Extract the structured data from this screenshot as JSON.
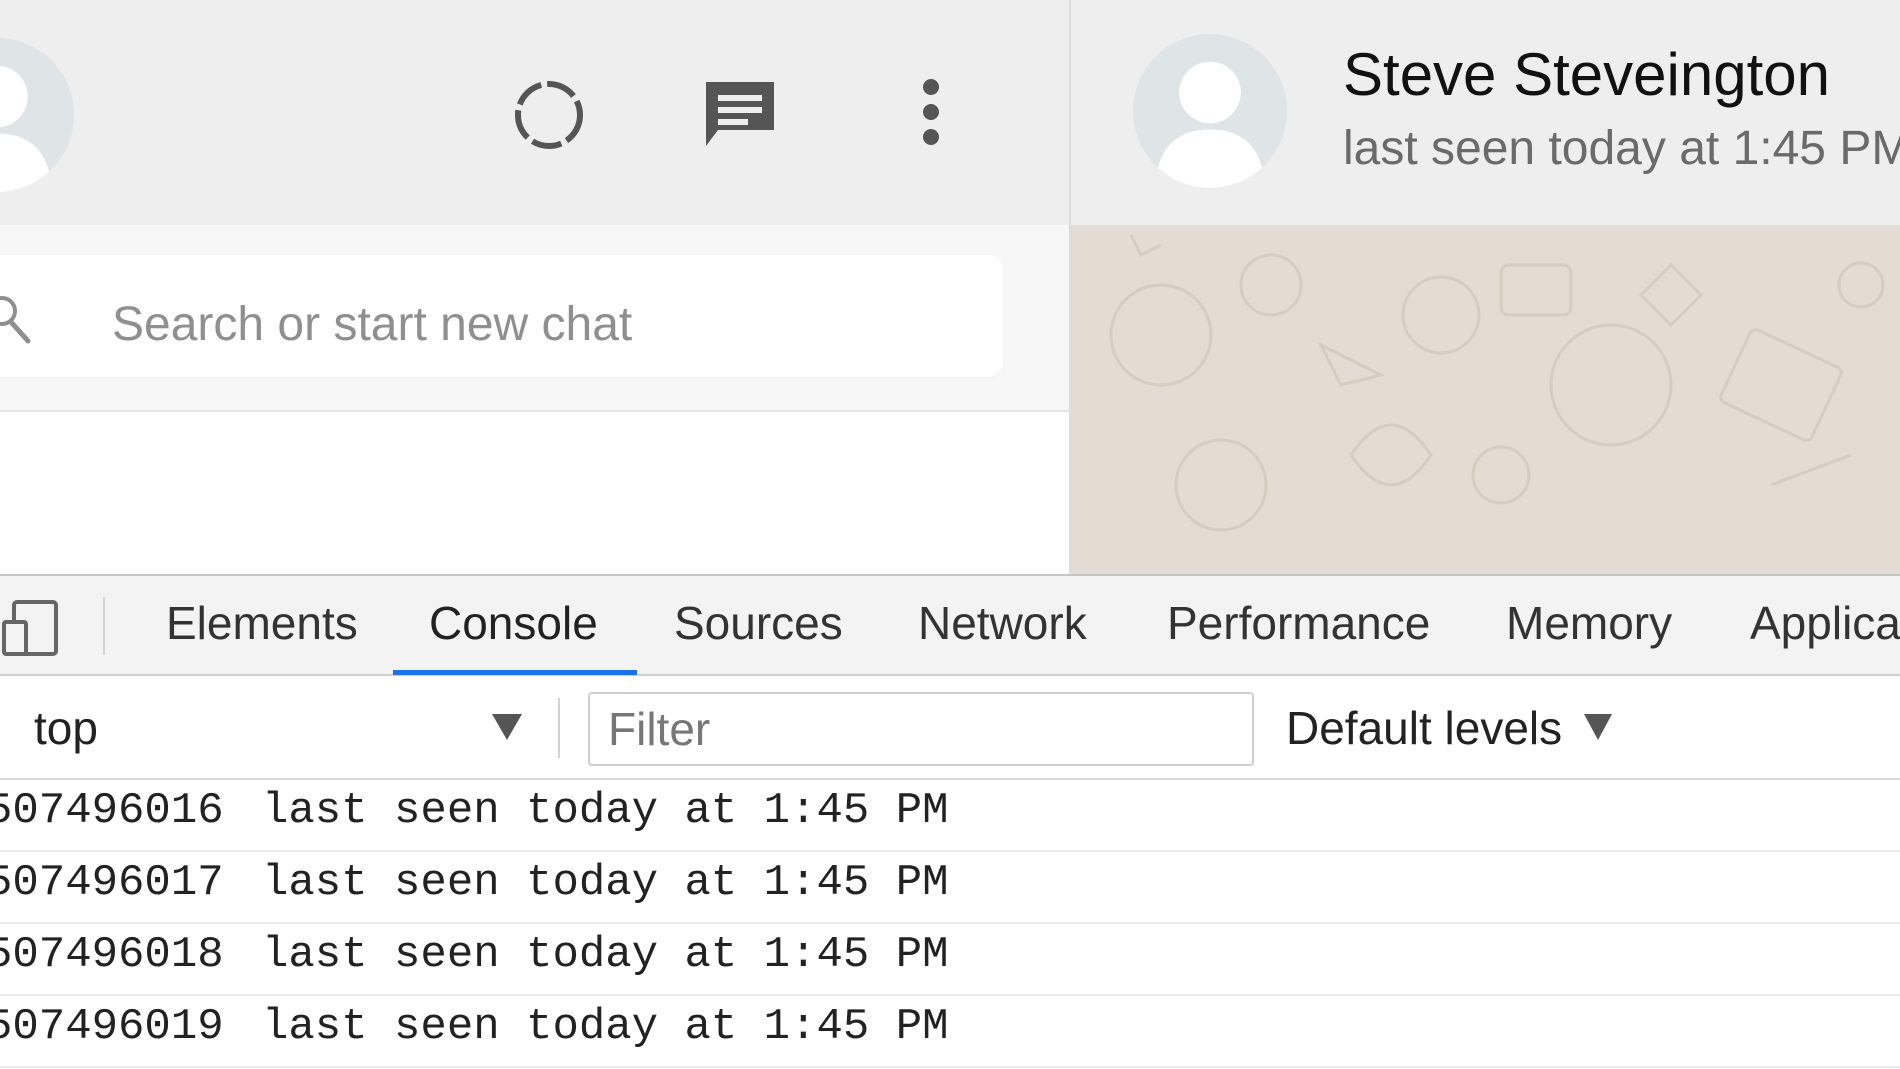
{
  "whatsapp": {
    "header_icons": [
      "status-icon",
      "new-chat-icon",
      "menu-icon"
    ],
    "search": {
      "placeholder": "Search or start new chat"
    },
    "contact": {
      "name": "Steve Steveington",
      "status": "last seen today at 1:45 PM"
    }
  },
  "devtools": {
    "tabs": [
      "Elements",
      "Console",
      "Sources",
      "Network",
      "Performance",
      "Memory",
      "Applica"
    ],
    "active_tab": "Console",
    "accent_color": "#1a73e8",
    "console": {
      "context": "top",
      "filter_placeholder": "Filter",
      "levels": "Default levels",
      "logs": [
        {
          "id": "507496016",
          "message": "last seen today at 1:45 PM"
        },
        {
          "id": "507496017",
          "message": "last seen today at 1:45 PM"
        },
        {
          "id": "507496018",
          "message": "last seen today at 1:45 PM"
        },
        {
          "id": "507496019",
          "message": "last seen today at 1:45 PM"
        }
      ]
    }
  }
}
